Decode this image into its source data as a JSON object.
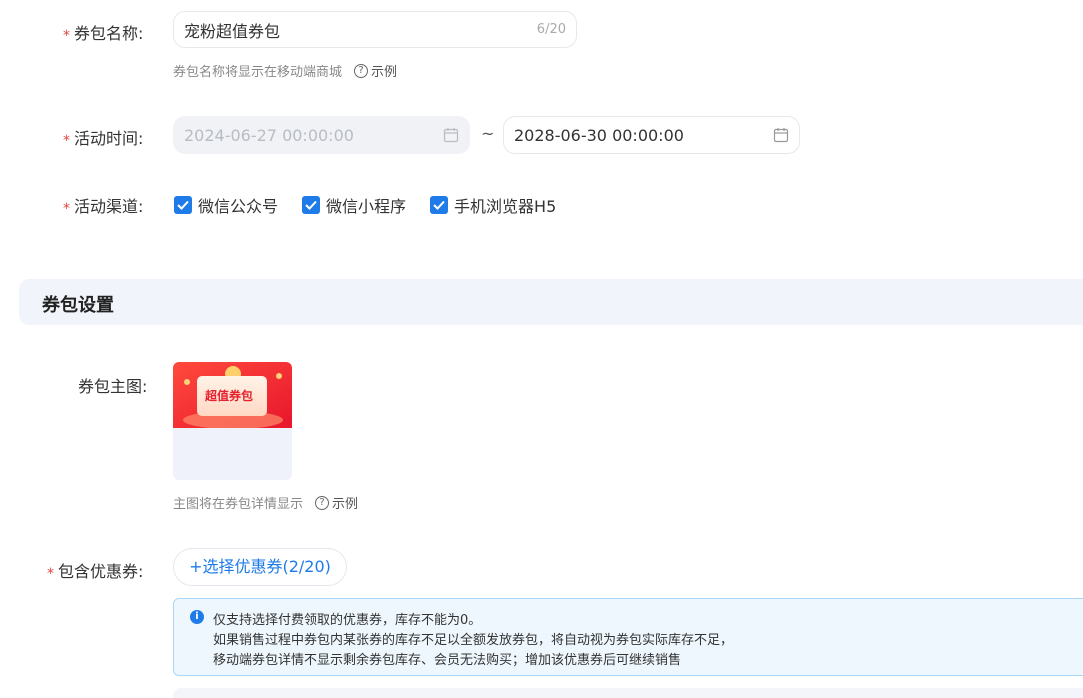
{
  "form": {
    "name": {
      "required_mark": "*",
      "label": "券包名称:",
      "value": "宠粉超值券包",
      "count": "6/20",
      "hint": "券包名称将显示在移动端商城",
      "example": "示例"
    },
    "time": {
      "required_mark": "*",
      "label": "活动时间:",
      "start": "2024-06-27 00:00:00",
      "separator": "~",
      "end": "2028-06-30 00:00:00"
    },
    "channel": {
      "required_mark": "*",
      "label": "活动渠道:",
      "options": [
        {
          "label": "微信公众号",
          "checked": true
        },
        {
          "label": "微信小程序",
          "checked": true
        },
        {
          "label": "手机浏览器H5",
          "checked": true
        }
      ]
    }
  },
  "section": {
    "title": "券包设置"
  },
  "image": {
    "label": "券包主图:",
    "thumb_text": "超值券包",
    "hint": "主图将在券包详情显示",
    "example": "示例"
  },
  "coupons": {
    "required_mark": "*",
    "label": "包含优惠券:",
    "button": "+选择优惠券(2/20)",
    "notice": [
      "仅支持选择付费领取的优惠券，库存不能为0。",
      "如果销售过程中券包内某张券的库存不足以全额发放券包，将自动视为券包实际库存不足，",
      "移动端券包详情不显示剩余券包库存、会员无法购买；增加该优惠券后可继续销售"
    ]
  },
  "colors": {
    "accent": "#1f7be8",
    "required": "#e64340",
    "section_bg": "#f1f4fb",
    "notice_bg": "#eef7fd"
  }
}
